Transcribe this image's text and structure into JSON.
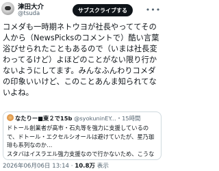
{
  "author": {
    "name": "津田大介",
    "handle": "@tsuda"
  },
  "header": {
    "subscribe_label": "サブスクライブする",
    "more_icon": "more-dots-icon"
  },
  "tweet": {
    "text": "コメダも一時期ネトウヨが社長やっててその人から（NewsPicksのコメントで）酷い言葉浴びせられたこともあるので（いまは社長変わってるけど）よほどのことがない限り行かないようにしてます。みんなふんわりコメダの印象いいけど、このことあんま知られてないよね。"
  },
  "quote": {
    "name": "なたり",
    "name_suffix": "ー■東２で15b",
    "handle": "@syokuninEY...",
    "dot": "・",
    "time": "15時間",
    "text": "ドトール創業者が高市・石丸等を強力に支援しているので、ドトール・エクセルシオールは避けていたが、星乃珈琲も系列なのか…\nスタバはイスラエル強力支援なので行かないため、こうなるとチェーンは選択肢狭まる。コメ…"
  },
  "footer": {
    "timestamp": "2026年06月06日 13:14 · ",
    "views_count": "10.8万",
    "views_label": " 表示"
  }
}
